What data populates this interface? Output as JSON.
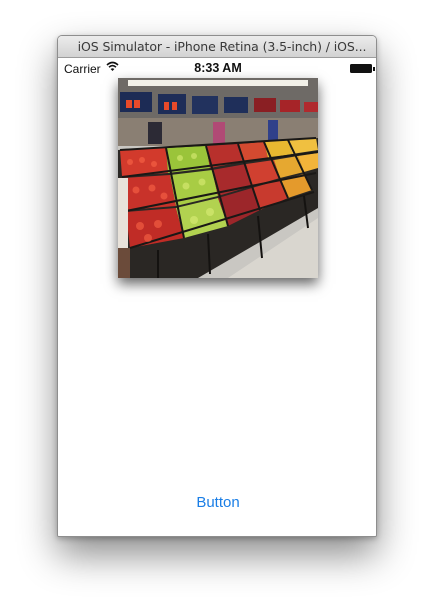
{
  "window": {
    "title": "iOS Simulator - iPhone Retina (3.5-inch) / iOS..."
  },
  "statusbar": {
    "carrier": "Carrier",
    "time": "8:33 AM"
  },
  "image": {
    "subject": "supermarket fruit display"
  },
  "main": {
    "button_label": "Button"
  },
  "colors": {
    "accent": "#1a7ee6"
  }
}
